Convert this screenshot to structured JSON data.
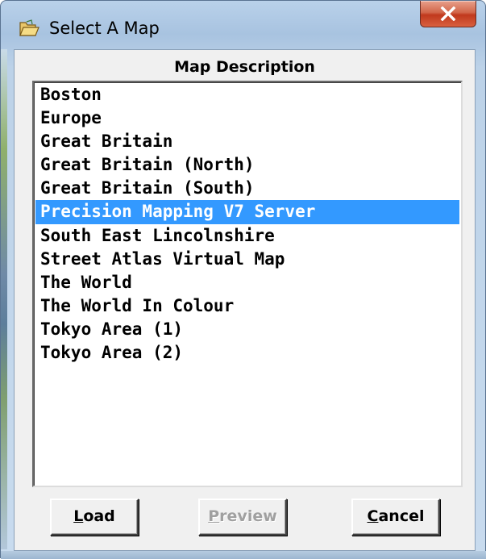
{
  "window": {
    "title": "Select A Map",
    "close_glyph": "X"
  },
  "list": {
    "header": "Map Description",
    "selected_index": 5,
    "items": [
      "Boston",
      "Europe",
      "Great Britain",
      "Great Britain (North)",
      "Great Britain (South)",
      "Precision Mapping V7 Server",
      "South East Lincolnshire",
      "Street Atlas Virtual Map",
      "The World",
      "The World In Colour",
      "Tokyo Area (1)",
      "Tokyo Area (2)"
    ]
  },
  "buttons": {
    "load": {
      "accel": "L",
      "rest": "oad",
      "enabled": true
    },
    "preview": {
      "accel": "P",
      "rest": "review",
      "enabled": false
    },
    "cancel": {
      "accel": "C",
      "rest": "ancel",
      "enabled": true
    }
  },
  "colors": {
    "selection_bg": "#3399ff",
    "selection_fg": "#ffffff",
    "close_button": "#c0391d"
  },
  "icons": {
    "title": "folder-open-icon",
    "close": "close-icon"
  }
}
